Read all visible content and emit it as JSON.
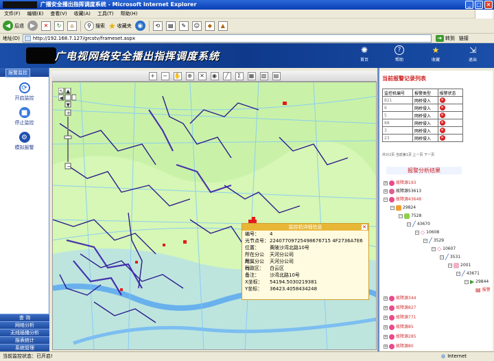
{
  "window": {
    "title": "广播安全播出指挥调度系统 - Microsoft Internet Explorer"
  },
  "menu": [
    "文件(F)",
    "编辑(E)",
    "查看(V)",
    "收藏(A)",
    "工具(T)",
    "帮助(H)"
  ],
  "toolbar": {
    "back": "后退",
    "search": "搜索",
    "favorites": "收藏夹"
  },
  "address": {
    "label": "地址(D)",
    "url": "http://192.168.7.127/grcstv/frameset.aspx",
    "go": "转到",
    "links": "链接"
  },
  "app": {
    "title": "广电视网络安全播出指挥调度系统",
    "header_buttons": [
      "首页",
      "帮助",
      "收藏",
      "退出"
    ]
  },
  "sidebar": {
    "tab": "报警监控",
    "items": [
      "开启监控",
      "停止监控",
      "模拟报警"
    ],
    "menu": [
      "查  询",
      "网络分析",
      "无线插播分析",
      "报表统计",
      "系统管理"
    ]
  },
  "popup": {
    "title": "监控机详细信息",
    "rows": [
      {
        "k": "编号：",
        "v": "4"
      },
      {
        "k": "光节点号：",
        "v": "22407709725498676715 4F2736A7E6"
      },
      {
        "k": "位置：",
        "v": "黄陂沙湾北路10号"
      },
      {
        "k": "所在分公司：",
        "v": "天河分公司"
      },
      {
        "k": "所属分公司：",
        "v": "天河分公司"
      },
      {
        "k": "行政区：",
        "v": "白云区"
      },
      {
        "k": "备注：",
        "v": "沙湾北路10号"
      },
      {
        "k": "X坐标：",
        "v": "54194.5030219381"
      },
      {
        "k": "Y坐标：",
        "v": "36423.4058434248"
      }
    ]
  },
  "alarms": {
    "title": "当前报警记录列表",
    "headers": [
      "监控机编号",
      "报警类型",
      "报警状态"
    ],
    "rows": [
      [
        "821",
        "网桥侵入"
      ],
      [
        "6",
        "网桥侵入"
      ],
      [
        "5",
        "网桥侵入"
      ],
      [
        "88",
        "网桥侵入"
      ],
      [
        "3",
        "网桥侵入"
      ],
      [
        "23",
        "网桥侵入"
      ]
    ],
    "pager": "共计2页 当前第1页    上一页 下一页"
  },
  "analysis": {
    "title": "报警分析结果",
    "nodes": [
      {
        "text": "故障源193",
        "red": true
      },
      {
        "text": "故障源53613",
        "red": false
      },
      {
        "text": "故障源43648",
        "red": true
      },
      {
        "text": "29824",
        "red": false
      },
      {
        "text": "7528",
        "red": false
      },
      {
        "text": "43670",
        "red": false
      },
      {
        "text": "10608",
        "red": false
      },
      {
        "text": "3529",
        "red": false
      },
      {
        "text": "10607",
        "red": false
      },
      {
        "text": "3531",
        "red": false
      },
      {
        "text": "2001",
        "red": false
      },
      {
        "text": "43671",
        "red": false
      },
      {
        "text": "29844",
        "red": false
      },
      {
        "text": "报警",
        "red": true
      },
      {
        "text": "故障源344",
        "red": true
      },
      {
        "text": "故障源827",
        "red": true
      },
      {
        "text": "故障源771",
        "red": true
      },
      {
        "text": "故障源85",
        "red": true
      },
      {
        "text": "故障源285",
        "red": true
      },
      {
        "text": "故障源80",
        "red": true
      }
    ]
  },
  "status": {
    "left": "当前监控状态：已开启!",
    "zone": "Internet"
  }
}
